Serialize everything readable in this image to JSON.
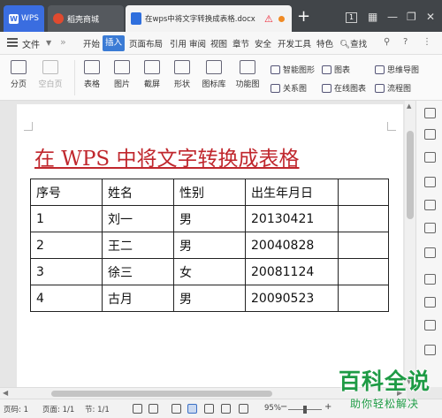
{
  "titlebar": {
    "tabs": [
      {
        "label": "WPS",
        "icon": "wps-logo-icon"
      },
      {
        "label": "稻壳商城",
        "icon": "docer-store-icon"
      },
      {
        "label": "在wps中将文字转换成表格.docx",
        "icon": "word-doc-icon"
      }
    ],
    "add_tab": "+",
    "page_count": "1"
  },
  "menubar": {
    "file": "文件",
    "items": [
      "开始",
      "插入",
      "页面布局",
      "引用",
      "审阅",
      "视图",
      "章节",
      "安全",
      "开发工具",
      "特色"
    ],
    "active": "插入",
    "search": "查找"
  },
  "ribbon": {
    "page_break": "分页",
    "blank_page": "空白页",
    "table": "表格",
    "picture": "图片",
    "screenshot": "截屏",
    "shape": "形状",
    "gallery": "图标库",
    "function_chart": "功能图",
    "smart_graphic": "智能图形",
    "chart": "图表",
    "relation_chart": "关系图",
    "online_chart": "在线图表",
    "mind_map": "思维导图",
    "flowchart": "流程图"
  },
  "document": {
    "title": "在 WPS 中将文字转换成表格",
    "table": {
      "rows": [
        [
          "序号",
          "姓名",
          "性别",
          "出生年月日",
          ""
        ],
        [
          "1",
          "刘一",
          "男",
          "20130421",
          ""
        ],
        [
          "2",
          "王二",
          "男",
          "20040828",
          ""
        ],
        [
          "3",
          "徐三",
          "女",
          "20081124",
          ""
        ],
        [
          "4",
          "古月",
          "男",
          "20090523",
          ""
        ]
      ]
    }
  },
  "statusbar": {
    "page_code": "页码: 1",
    "page": "页面: 1/1",
    "section": "节: 1/1",
    "zoom": "95%",
    "zoom_minus": "−",
    "zoom_plus": "+"
  },
  "watermark": {
    "main": "百科全说",
    "sub": "助你轻松解决"
  },
  "colors": {
    "title_red": "#c0272d",
    "accent_blue": "#3a7bd5",
    "titlebar": "#414549",
    "watermark_green": "#1e9b45"
  }
}
